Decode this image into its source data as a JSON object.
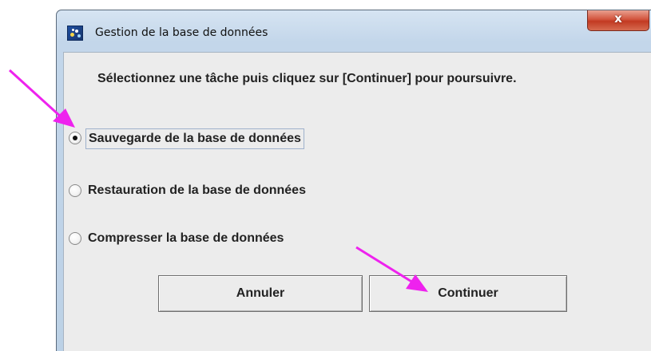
{
  "window": {
    "title": "Gestion de la base de données",
    "close_glyph": "x",
    "icon": "app-database-icon"
  },
  "dialog": {
    "instruction": "Sélectionnez une tâche puis cliquez sur [Continuer] pour poursuivre.",
    "options": [
      {
        "label": "Sauvegarde de la base de données",
        "selected": true
      },
      {
        "label": "Restauration de la base de données",
        "selected": false
      },
      {
        "label": "Compresser la base de données",
        "selected": false
      }
    ],
    "buttons": {
      "cancel_label": "Annuler",
      "continue_label": "Continuer"
    }
  },
  "annotations": {
    "arrow_color": "#ee22ee",
    "arrows": [
      "arrow-to-option-backup",
      "arrow-to-continue-button"
    ]
  }
}
